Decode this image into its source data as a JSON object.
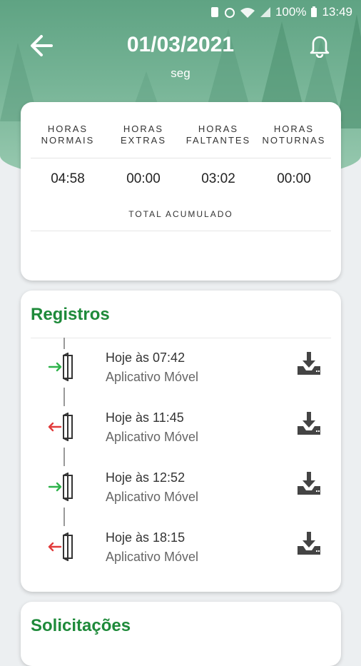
{
  "status_bar": {
    "battery": "100%",
    "time": "13:49"
  },
  "header": {
    "date": "01/03/2021",
    "weekday": "seg"
  },
  "summary": {
    "columns": [
      {
        "label_line1": "HORAS",
        "label_line2": "NORMAIS",
        "value": "04:58"
      },
      {
        "label_line1": "HORAS",
        "label_line2": "EXTRAS",
        "value": "00:00"
      },
      {
        "label_line1": "HORAS",
        "label_line2": "FALTANTES",
        "value": "03:02"
      },
      {
        "label_line1": "HORAS",
        "label_line2": "NOTURNAS",
        "value": "00:00"
      }
    ],
    "total_label": "TOTAL ACUMULADO"
  },
  "registros": {
    "title": "Registros",
    "entries": [
      {
        "time": "Hoje às 07:42",
        "source": "Aplicativo Móvel",
        "direction": "in",
        "icon": "door-enter-icon"
      },
      {
        "time": "Hoje às 11:45",
        "source": "Aplicativo Móvel",
        "direction": "out",
        "icon": "door-exit-icon"
      },
      {
        "time": "Hoje às 12:52",
        "source": "Aplicativo Móvel",
        "direction": "in",
        "icon": "door-enter-icon"
      },
      {
        "time": "Hoje às 18:15",
        "source": "Aplicativo Móvel",
        "direction": "out",
        "icon": "door-exit-icon"
      }
    ]
  },
  "solicitacoes": {
    "title": "Solicitações"
  },
  "colors": {
    "brand_green": "#1e8a3a",
    "in_arrow": "#2eb34b",
    "out_arrow": "#e23b3b",
    "header_green": "#6aae8d"
  }
}
